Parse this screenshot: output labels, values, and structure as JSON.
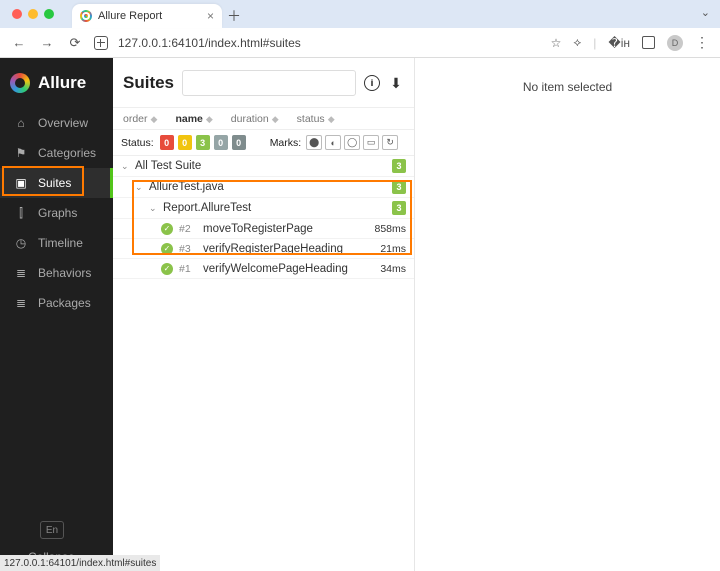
{
  "browser": {
    "tab_title": "Allure Report",
    "url": "127.0.0.1:64101/index.html#suites",
    "avatar_initial": "D",
    "status_text": "127.0.0.1:64101/index.html#suites"
  },
  "sidebar": {
    "brand": "Allure",
    "items": [
      {
        "icon": "home-icon",
        "glyph": "⌂",
        "label": "Overview"
      },
      {
        "icon": "flag-icon",
        "glyph": "⚑",
        "label": "Categories"
      },
      {
        "icon": "briefcase-icon",
        "glyph": "▣",
        "label": "Suites"
      },
      {
        "icon": "chart-icon",
        "glyph": "⫿",
        "label": "Graphs"
      },
      {
        "icon": "clock-icon",
        "glyph": "◷",
        "label": "Timeline"
      },
      {
        "icon": "list-icon",
        "glyph": "≣",
        "label": "Behaviors"
      },
      {
        "icon": "layers-icon",
        "glyph": "≣",
        "label": "Packages"
      }
    ],
    "lang": "En",
    "collapse": "Collapse"
  },
  "panel": {
    "title": "Suites",
    "search_placeholder": "",
    "sort": {
      "order": "order",
      "name": "name",
      "duration": "duration",
      "status": "status"
    },
    "status": {
      "label": "Status:",
      "counts": [
        {
          "color": "#e74c3c",
          "value": "0"
        },
        {
          "color": "#f1c40f",
          "value": "0"
        },
        {
          "color": "#8bc34a",
          "value": "3"
        },
        {
          "color": "#95a5a6",
          "value": "0"
        },
        {
          "color": "#7f8c8d",
          "value": "0"
        }
      ]
    },
    "marks": {
      "label": "Marks:",
      "items": [
        "⬤",
        "◐",
        "◯",
        "▭",
        "↻"
      ]
    },
    "tree": {
      "root": {
        "label": "All Test Suite",
        "count": "3"
      },
      "file": {
        "label": "AllureTest.java",
        "count": "3"
      },
      "class": {
        "label": "Report.AllureTest",
        "count": "3"
      },
      "tests": [
        {
          "num": "#2",
          "name": "moveToRegisterPage",
          "duration": "858ms"
        },
        {
          "num": "#3",
          "name": "verifyRegisterPageHeading",
          "duration": "21ms"
        },
        {
          "num": "#1",
          "name": "verifyWelcomePageHeading",
          "duration": "34ms"
        }
      ]
    }
  },
  "detail": {
    "empty": "No item selected"
  }
}
